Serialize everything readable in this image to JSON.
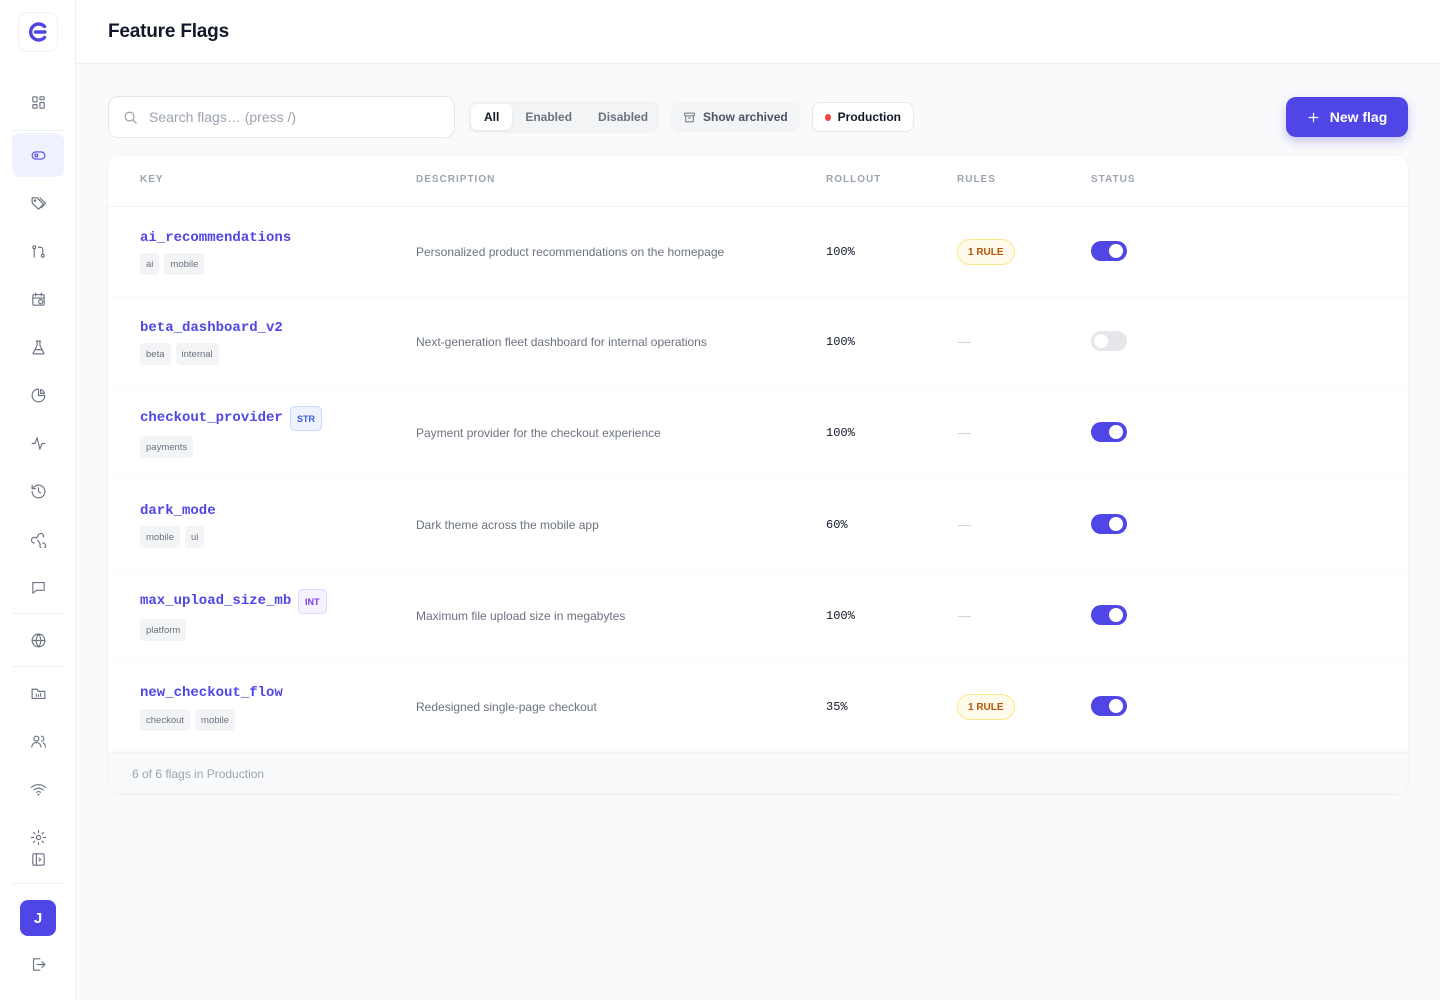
{
  "page": {
    "title": "Feature Flags"
  },
  "user": {
    "initial": "J"
  },
  "colors": {
    "accent": "#4f46e5",
    "env_dot": "#ef4444",
    "rule_badge": "#b45309"
  },
  "sidebar": {
    "icons": [
      "dashboard-icon",
      "feature-flags-icon",
      "segments-tag-icon",
      "experiments-branch-icon",
      "schedule-icon",
      "lab-flask-icon",
      "analytics-pie-icon",
      "activity-pulse-icon",
      "history-icon",
      "webhooks-icon",
      "feedback-icon",
      "environments-globe-icon",
      "projects-folder-icon",
      "team-users-icon",
      "connectivity-wifi-icon",
      "settings-gear-icon",
      "collapse-sidebar-icon",
      "logout-icon"
    ]
  },
  "toolbar": {
    "search_placeholder": "Search flags… (press /)",
    "filters": [
      "All",
      "Enabled",
      "Disabled"
    ],
    "active_filter": "All",
    "show_archived": "Show archived",
    "environment": "Production",
    "new_flag": "New flag"
  },
  "table": {
    "headers": {
      "key": "KEY",
      "description": "DESCRIPTION",
      "rollout": "ROLLOUT",
      "rules": "RULES",
      "status": "STATUS"
    },
    "rows": [
      {
        "key": "ai_recommendations",
        "type": "",
        "tags": [
          "ai",
          "mobile"
        ],
        "description": "Personalized product recommendations on the homepage",
        "rollout": "100%",
        "rules": "1 RULE",
        "enabled": true
      },
      {
        "key": "beta_dashboard_v2",
        "type": "",
        "tags": [
          "beta",
          "internal"
        ],
        "description": "Next-generation fleet dashboard for internal operations",
        "rollout": "100%",
        "rules": "",
        "enabled": false
      },
      {
        "key": "checkout_provider",
        "type": "STR",
        "tags": [
          "payments"
        ],
        "description": "Payment provider for the checkout experience",
        "rollout": "100%",
        "rules": "",
        "enabled": true
      },
      {
        "key": "dark_mode",
        "type": "",
        "tags": [
          "mobile",
          "ui"
        ],
        "description": "Dark theme across the mobile app",
        "rollout": "60%",
        "rules": "",
        "enabled": true
      },
      {
        "key": "max_upload_size_mb",
        "type": "INT",
        "tags": [
          "platform"
        ],
        "description": "Maximum file upload size in megabytes",
        "rollout": "100%",
        "rules": "",
        "enabled": true
      },
      {
        "key": "new_checkout_flow",
        "type": "",
        "tags": [
          "checkout",
          "mobile"
        ],
        "description": "Redesigned single-page checkout",
        "rollout": "35%",
        "rules": "1 RULE",
        "enabled": true
      }
    ],
    "footer": "6 of 6 flags in Production"
  }
}
